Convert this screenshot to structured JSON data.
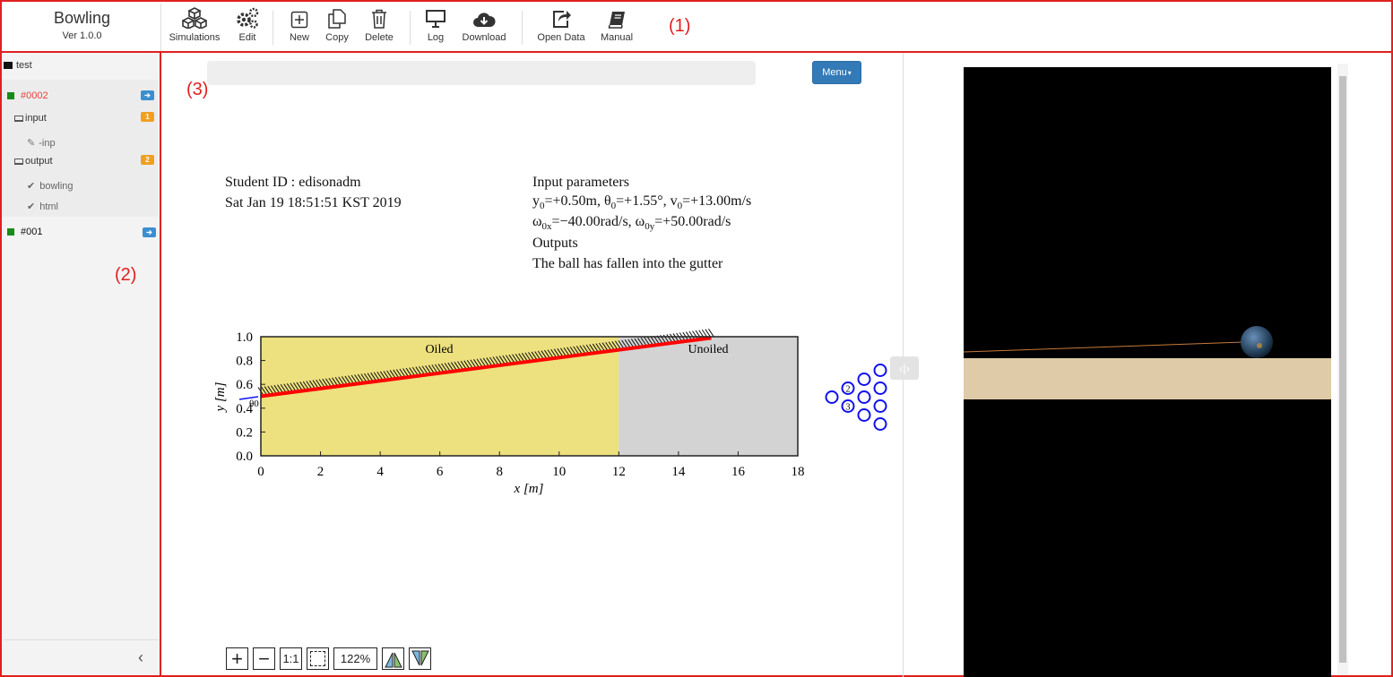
{
  "app": {
    "title": "Bowling",
    "version": "Ver 1.0.0"
  },
  "toolbar": {
    "buttons": [
      {
        "label": "Simulations",
        "icon": "cubes-icon"
      },
      {
        "label": "Edit",
        "icon": "gears-icon"
      },
      {
        "label": "New",
        "icon": "plus-square-icon"
      },
      {
        "label": "Copy",
        "icon": "copy-icon"
      },
      {
        "label": "Delete",
        "icon": "trash-icon"
      },
      {
        "label": "Log",
        "icon": "monitor-icon"
      },
      {
        "label": "Download",
        "icon": "cloud-download-icon"
      },
      {
        "label": "Open Data",
        "icon": "share-icon"
      },
      {
        "label": "Manual",
        "icon": "book-icon"
      }
    ]
  },
  "callouts": {
    "toolbar": "(1)",
    "sidebar": "(2)",
    "viewer": "(3)"
  },
  "sidebar": {
    "root": "test",
    "jobs": [
      {
        "id": "#0002",
        "selected": true,
        "color": "#e84040"
      },
      {
        "id": "#001",
        "selected": false,
        "color": "#111111"
      }
    ],
    "input": {
      "label": "input",
      "count": "1",
      "files": [
        "-inp"
      ]
    },
    "output": {
      "label": "output",
      "count": "2",
      "files": [
        "bowling",
        "html"
      ]
    }
  },
  "viewer": {
    "menu_label": "Menu",
    "student_line": "Student ID : edisonadm",
    "date_line": "Sat Jan 19 18:51:51 KST 2019",
    "params_header": "Input parameters",
    "params_line1": {
      "y": "y",
      "y_sub": "0",
      "y_val": "=+0.50m, θ",
      "t_sub": "0",
      "t_val": "=+1.55°, v",
      "v_sub": "0",
      "v_val": "=+13.00m/s"
    },
    "params_line2": {
      "w": "ω",
      "wx_sub": "0x",
      "wx_val": "=−40.00rad/s, ω",
      "wy_sub": "0y",
      "wy_val": "=+50.00rad/s"
    },
    "outputs_header": "Outputs",
    "outputs_text": "The ball has fallen into the gutter",
    "zoom": {
      "level": "122%",
      "one_to_one": "1:1"
    }
  },
  "chart_data": {
    "type": "line",
    "xlabel": "x [m]",
    "ylabel": "y [m]",
    "xlim": [
      0,
      18
    ],
    "ylim": [
      0.0,
      1.0
    ],
    "xticks": [
      "0",
      "2",
      "4",
      "6",
      "8",
      "10",
      "12",
      "14",
      "16",
      "18"
    ],
    "yticks": [
      "0.0",
      "0.2",
      "0.4",
      "0.6",
      "0.8",
      "1.0"
    ],
    "regions": [
      {
        "label": "Oiled",
        "x": [
          0,
          12
        ],
        "color": "#ede07e"
      },
      {
        "label": "Unoiled",
        "x": [
          12,
          18
        ],
        "color": "#d3d3d3"
      }
    ],
    "annotation": "θ0",
    "trajectory": {
      "x": [
        0,
        15.1
      ],
      "y": [
        0.5,
        0.99
      ],
      "color": "#ff0000"
    },
    "pins": {
      "color": "#1010ee",
      "labels": [
        "2",
        "3"
      ]
    }
  },
  "colors": {
    "accent_red": "#e02020",
    "menu_blue": "#337ab7"
  }
}
